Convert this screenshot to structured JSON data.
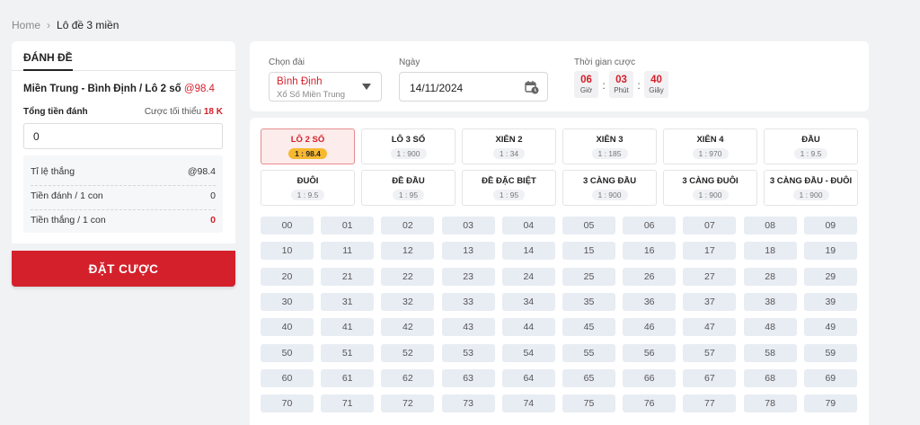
{
  "breadcrumb": {
    "home": "Home",
    "current": "Lô đề 3 miền"
  },
  "left_panel": {
    "tab": "ĐÁNH ĐỀ",
    "game_title": "Miền Trung - Bình Định / Lô 2 số",
    "game_rate": "@98.4",
    "total_label": "Tổng tiền đánh",
    "min_bet_label": "Cược tối thiểu",
    "min_bet_value": "18 K",
    "amount_value": "0",
    "stats": [
      {
        "label": "Tỉ lệ thắng",
        "value": "@98.4",
        "highlight": false
      },
      {
        "label": "Tiền đánh / 1 con",
        "value": "0",
        "highlight": false
      },
      {
        "label": "Tiền thắng / 1 con",
        "value": "0",
        "highlight": true
      }
    ],
    "bet_button": "ĐẶT CƯỢC"
  },
  "selectors": {
    "station_label": "Chọn đài",
    "station_name": "Bình Định",
    "station_sub": "Xổ Số Miền Trung",
    "date_label": "Ngày",
    "date_value": "14/11/2024",
    "time_label": "Thời gian cược",
    "countdown": [
      {
        "value": "06",
        "unit": "Giờ"
      },
      {
        "value": "03",
        "unit": "Phút"
      },
      {
        "value": "40",
        "unit": "Giây"
      }
    ]
  },
  "game_types": [
    {
      "name": "LÔ 2 SỐ",
      "rate": "1 : 98.4",
      "active": true
    },
    {
      "name": "LÔ 3 SỐ",
      "rate": "1 : 900",
      "active": false
    },
    {
      "name": "XIÊN 2",
      "rate": "1 : 34",
      "active": false
    },
    {
      "name": "XIÊN 3",
      "rate": "1 : 185",
      "active": false
    },
    {
      "name": "XIÊN 4",
      "rate": "1 : 970",
      "active": false
    },
    {
      "name": "ĐẦU",
      "rate": "1 : 9.5",
      "active": false
    },
    {
      "name": "ĐUÔI",
      "rate": "1 : 9.5",
      "active": false
    },
    {
      "name": "ĐỀ ĐẦU",
      "rate": "1 : 95",
      "active": false
    },
    {
      "name": "ĐỀ ĐẶC BIỆT",
      "rate": "1 : 95",
      "active": false
    },
    {
      "name": "3 CÀNG ĐẦU",
      "rate": "1 : 900",
      "active": false
    },
    {
      "name": "3 CÀNG ĐUÔI",
      "rate": "1 : 900",
      "active": false
    },
    {
      "name": "3 CÀNG ĐẦU - ĐUÔI",
      "rate": "1 : 900",
      "active": false
    }
  ],
  "numbers": [
    "00",
    "01",
    "02",
    "03",
    "04",
    "05",
    "06",
    "07",
    "08",
    "09",
    "10",
    "11",
    "12",
    "13",
    "14",
    "15",
    "16",
    "17",
    "18",
    "19",
    "20",
    "21",
    "22",
    "23",
    "24",
    "25",
    "26",
    "27",
    "28",
    "29",
    "30",
    "31",
    "32",
    "33",
    "34",
    "35",
    "36",
    "37",
    "38",
    "39",
    "40",
    "41",
    "42",
    "43",
    "44",
    "45",
    "46",
    "47",
    "48",
    "49",
    "50",
    "51",
    "52",
    "53",
    "54",
    "55",
    "56",
    "57",
    "58",
    "59",
    "60",
    "61",
    "62",
    "63",
    "64",
    "65",
    "66",
    "67",
    "68",
    "69",
    "70",
    "71",
    "72",
    "73",
    "74",
    "75",
    "76",
    "77",
    "78",
    "79"
  ],
  "colors": {
    "accent": "#d4202b",
    "active_rate_badge": "#f6b830",
    "cell_bg": "#e8ecf3"
  }
}
